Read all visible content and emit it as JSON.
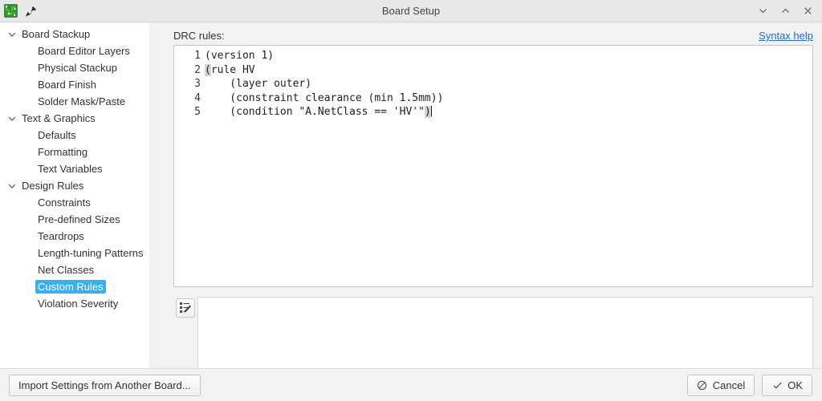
{
  "window": {
    "title": "Board Setup",
    "app_icon": "pcb-board-icon",
    "pin_icon": "pin-icon",
    "controls": {
      "minimize": "chevron-down-icon",
      "maximize": "chevron-up-icon",
      "close": "close-icon"
    }
  },
  "sidebar": {
    "items": [
      {
        "label": "Board Stackup",
        "level": 0,
        "expanded": true,
        "selected": false
      },
      {
        "label": "Board Editor Layers",
        "level": 1,
        "expanded": null,
        "selected": false
      },
      {
        "label": "Physical Stackup",
        "level": 1,
        "expanded": null,
        "selected": false
      },
      {
        "label": "Board Finish",
        "level": 1,
        "expanded": null,
        "selected": false
      },
      {
        "label": "Solder Mask/Paste",
        "level": 1,
        "expanded": null,
        "selected": false
      },
      {
        "label": "Text & Graphics",
        "level": 0,
        "expanded": true,
        "selected": false
      },
      {
        "label": "Defaults",
        "level": 1,
        "expanded": null,
        "selected": false
      },
      {
        "label": "Formatting",
        "level": 1,
        "expanded": null,
        "selected": false
      },
      {
        "label": "Text Variables",
        "level": 1,
        "expanded": null,
        "selected": false
      },
      {
        "label": "Design Rules",
        "level": 0,
        "expanded": true,
        "selected": false
      },
      {
        "label": "Constraints",
        "level": 1,
        "expanded": null,
        "selected": false
      },
      {
        "label": "Pre-defined Sizes",
        "level": 1,
        "expanded": null,
        "selected": false
      },
      {
        "label": "Teardrops",
        "level": 1,
        "expanded": null,
        "selected": false
      },
      {
        "label": "Length-tuning Patterns",
        "level": 1,
        "expanded": null,
        "selected": false
      },
      {
        "label": "Net Classes",
        "level": 1,
        "expanded": null,
        "selected": false
      },
      {
        "label": "Custom Rules",
        "level": 1,
        "expanded": null,
        "selected": true
      },
      {
        "label": "Violation Severity",
        "level": 1,
        "expanded": null,
        "selected": false
      }
    ],
    "selection_color": "#3daee9"
  },
  "pane": {
    "label": "DRC rules:",
    "syntax_help_label": "Syntax help",
    "link_color": "#2a6bb5"
  },
  "editor": {
    "line_numbers": [
      "1",
      "2",
      "3",
      "4",
      "5"
    ],
    "lines": [
      {
        "text": "(version 1)"
      },
      {
        "pre": "",
        "bracket": "(",
        "post": "rule HV"
      },
      {
        "text": "    (layer outer)"
      },
      {
        "text": "    (constraint clearance (min 1.5mm))"
      },
      {
        "pre": "    (condition \"A.NetClass == 'HV'\"",
        "bracket": ")",
        "post": "",
        "caret": true
      }
    ],
    "bracket_highlight_color": "#d4d4d4"
  },
  "lower_panel": {
    "check_button_icon": "check-rules-icon",
    "output_text": ""
  },
  "footer": {
    "import_label": "Import Settings from Another Board...",
    "cancel_label": "Cancel",
    "cancel_icon": "cancel-circle-slash-icon",
    "ok_label": "OK",
    "ok_icon": "checkmark-icon"
  }
}
